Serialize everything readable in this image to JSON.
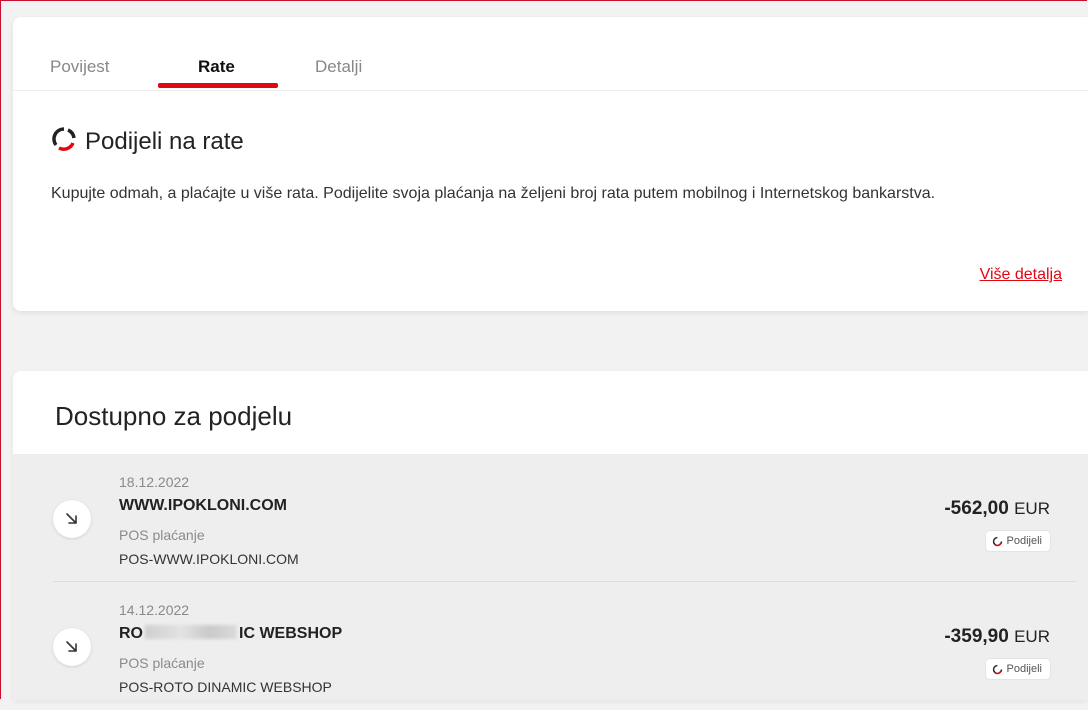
{
  "tabs": [
    {
      "label": "Povijest",
      "active": false
    },
    {
      "label": "Rate",
      "active": true
    },
    {
      "label": "Detalji",
      "active": false
    }
  ],
  "promo": {
    "icon": "split-ring-icon",
    "title": "Podijeli na rate",
    "description": "Kupujte odmah, a plaćajte u više rata. Podijelite svoja plaćanja na željeni broj rata putem mobilnog i Internetskog bankarstva.",
    "more_link": "Više detalja"
  },
  "list": {
    "title": "Dostupno za podjelu",
    "transactions": [
      {
        "date": "18.12.2022",
        "merchant": "WWW.IPOKLONI.COM",
        "type": "POS plaćanje",
        "reference": "POS-WWW.IPOKLONI.COM",
        "amount": "-562,00",
        "currency": "EUR",
        "action": "Podijeli",
        "icon": "arrow-down-right-icon"
      },
      {
        "date": "14.12.2022",
        "merchant_prefix": "RO",
        "merchant_suffix": "IC WEBSHOP",
        "type": "POS plaćanje",
        "reference": "POS-ROTO DINAMIC WEBSHOP",
        "amount": "-359,90",
        "currency": "EUR",
        "action": "Podijeli",
        "icon": "arrow-down-right-icon"
      }
    ]
  },
  "colors": {
    "accent": "#e30613",
    "background": "#f2f2f2"
  }
}
